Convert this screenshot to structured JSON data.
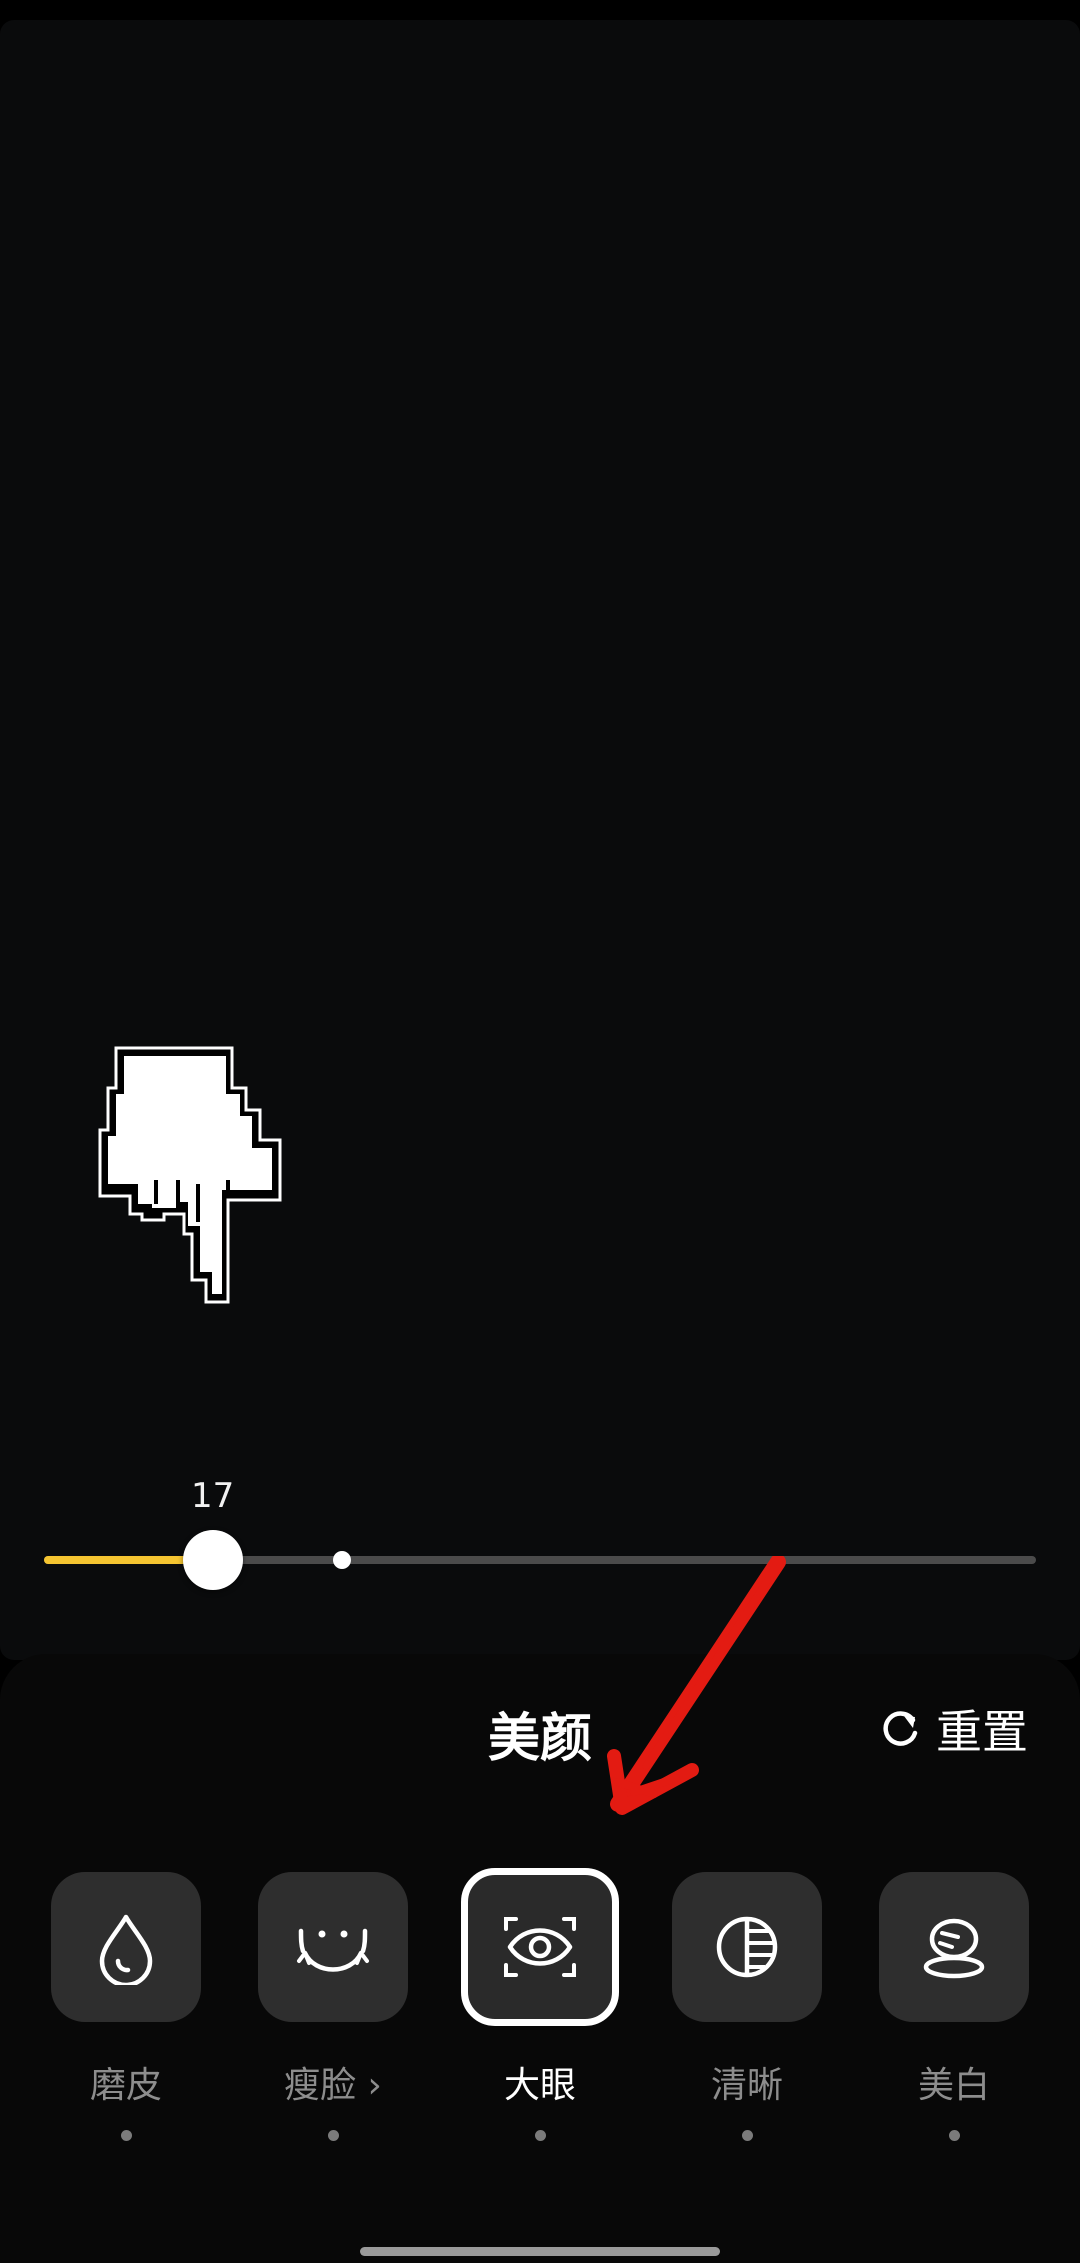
{
  "slider": {
    "value": 17,
    "value_label": "17",
    "max": 100,
    "default_value": 30,
    "fill_color": "#f5c531"
  },
  "panel": {
    "title": "美颜",
    "reset_label": "重置",
    "reset_icon": "refresh-icon"
  },
  "tools": [
    {
      "label": "磨皮",
      "icon": "droplet-icon",
      "selected": false
    },
    {
      "label": "瘦脸 ›",
      "icon": "face-smile-icon",
      "selected": false
    },
    {
      "label": "大眼",
      "icon": "eye-scan-icon",
      "selected": true
    },
    {
      "label": "清晰",
      "icon": "contrast-circle-icon",
      "selected": false
    },
    {
      "label": "美白",
      "icon": "stacked-stones-icon",
      "selected": false
    }
  ],
  "overlays": {
    "pointer_icon": "hand-pointer-icon",
    "annotation_icon": "red-arrow-icon",
    "annotation_color": "#e31b12"
  }
}
